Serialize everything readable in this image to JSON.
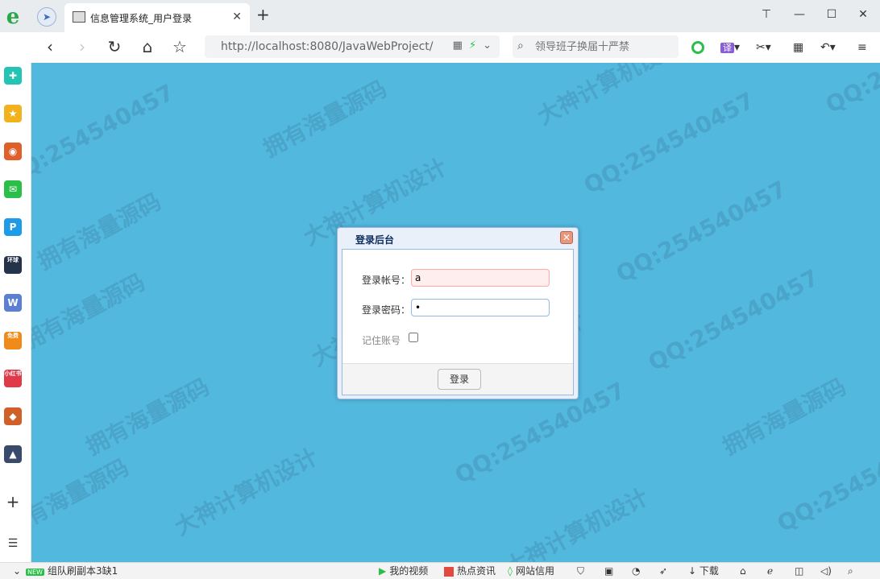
{
  "browser": {
    "logo": "e",
    "tab_title": "信息管理系统_用户登录",
    "tab_close": "✕",
    "new_tab": "+",
    "address": "http://localhost:8080/JavaWebProject/",
    "search_placeholder": "领导班子换届十严禁",
    "translate_ext": "译",
    "window_controls": {
      "shirt": "⊤",
      "minimize": "—",
      "maximize": "☐",
      "close": "✕"
    },
    "nav": {
      "back": "‹",
      "forward": "›",
      "reload": "↻",
      "home": "⌂",
      "star": "☆"
    }
  },
  "sidebar": {
    "items": [
      {
        "name": "health",
        "glyph": "✚",
        "color": "#23c4b4"
      },
      {
        "name": "favorites",
        "glyph": "★",
        "color": "#f2b21d"
      },
      {
        "name": "weibo",
        "glyph": "◉",
        "color": "#e0602c"
      },
      {
        "name": "mail",
        "glyph": "✉",
        "color": "#2bbf4a"
      },
      {
        "name": "pan",
        "glyph": "P",
        "color": "#1e9be6"
      },
      {
        "name": "news",
        "glyph": "环球",
        "color": "#24324a"
      },
      {
        "name": "doc",
        "glyph": "W",
        "color": "#5b7fd4"
      },
      {
        "name": "novel",
        "glyph": "免费",
        "color": "#f08a18"
      },
      {
        "name": "shop",
        "glyph": "小红书",
        "color": "#e03a4a"
      },
      {
        "name": "game1",
        "glyph": "◆",
        "color": "#d0602a"
      },
      {
        "name": "game2",
        "glyph": "▲",
        "color": "#3a4a6a"
      }
    ],
    "add": "+",
    "menu": "☰"
  },
  "watermarks": [
    "QQ:254540457",
    "拥有海量源码",
    "大神计算机设计"
  ],
  "dialog": {
    "title": "登录后台",
    "close": "✕",
    "username_label": "登录帐号：",
    "username_value": "a",
    "password_label": "登录密码：",
    "password_value": "•",
    "remember_label": "记住账号",
    "remember_checked": false,
    "login_button": "登录"
  },
  "statusbar": {
    "left_text": "组队刷副本3缺1",
    "new_badge": "NEW",
    "my_video": "我的视频",
    "hot_news": "热点资讯",
    "site_credit": "网站信用",
    "download": "下载"
  }
}
